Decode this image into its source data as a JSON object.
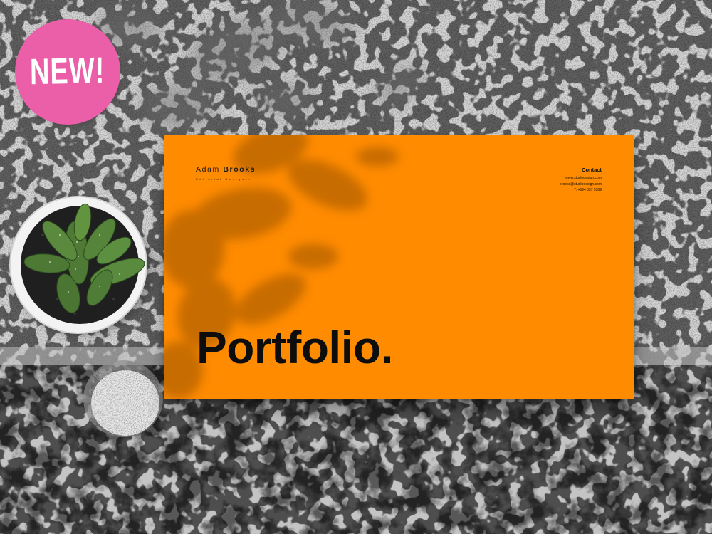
{
  "badge": {
    "label": "NEW!",
    "color": "#ea5fa8"
  },
  "card": {
    "color": "#ff8b00",
    "brand": {
      "first_name": "Adam",
      "last_name": "Brooks",
      "tagline": "Editorial Designer"
    },
    "contact": {
      "title": "Contact",
      "website": "www.studiodesign.com",
      "email": "brooks@studiodesign.com",
      "phone": "T. +694 837 9389"
    },
    "heading": "Portfolio."
  }
}
